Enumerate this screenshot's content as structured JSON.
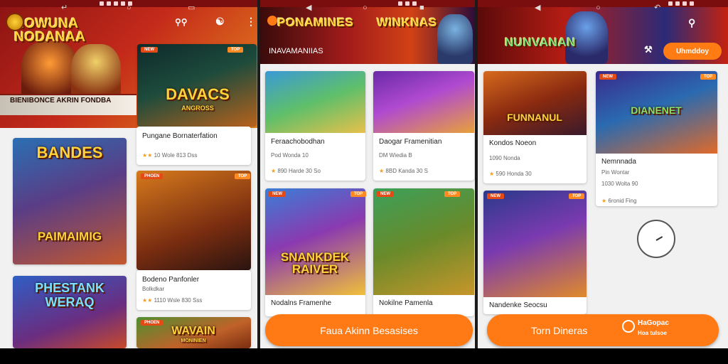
{
  "colors": {
    "accent": "#ff7a14",
    "brand_red": "#a21b1b",
    "status_bar": "#7a0d0d"
  },
  "screen1": {
    "banner_logo": "HOWUNA NODANAA",
    "banner_strip": "BIENIBONCE AKRIN FONDBA",
    "featured_tag": "NEW",
    "featured_badge": "TOP",
    "featured_title": "DAVACS",
    "featured_sub": "ANGROSS",
    "toolbar": {
      "icon1": "search-icon",
      "icon2": "people-icon",
      "icon3": "more-icon"
    },
    "cards": [
      {
        "title": "Pungane Bornaterfation",
        "rating": "10",
        "meta": "Wole 813 Dss"
      },
      {
        "title": "Bodeno Panfonler",
        "rating": "",
        "meta": "Bolkdkar",
        "meta2": "1110 Wsle 830 Sss"
      }
    ],
    "big_art": [
      {
        "top": "BANDES",
        "bottom": "PAIMAIMIG"
      },
      {
        "top": "PHESTANK",
        "bottom": "WERAQ"
      }
    ],
    "mid_art_tag": "PHOEN",
    "bottom_art_top": "WAVAIN",
    "bottom_art_sub": "MONINIEN"
  },
  "screen2": {
    "banner_logo": "PONAMINES",
    "banner_logo2": "WINKNAS",
    "banner_sub": "INAVAMANIIAS",
    "cards": [
      {
        "title": "Feraachobodhan",
        "meta1": "Pod Wonda 10",
        "meta2": "890 Harde 30 So"
      },
      {
        "title": "Daogar Framenitian",
        "meta1": "DM Wiedia B",
        "meta2": "8BD Kanda 30 S"
      },
      {
        "title": "Nodalns Framenhe"
      },
      {
        "title": "Nokilne Pamenla"
      }
    ],
    "art": {
      "banner": "SNANKDEK RAIVER"
    },
    "button": "Faua Akinn Besasises"
  },
  "screen3": {
    "banner_logo": "NUNVANAN",
    "button_top": "Uhmddoy",
    "cards": [
      {
        "title": "Kondos Noeon",
        "meta1": "1090 Nonda",
        "meta2": "590 Honda 30"
      },
      {
        "title": "Nemnnada",
        "meta1": "Pin Wontar",
        "meta2": "1030 Wolta 90"
      },
      {
        "title": "Nandenke Seocsu"
      }
    ],
    "card1_art": "FUNNANUL",
    "card2_art": "DIANENET",
    "featured_meta": "6ronid Fing",
    "button": "Torn Dineras",
    "button_badge_line1": "HaGopac",
    "button_badge_line2": "Hoa tulsoe"
  }
}
